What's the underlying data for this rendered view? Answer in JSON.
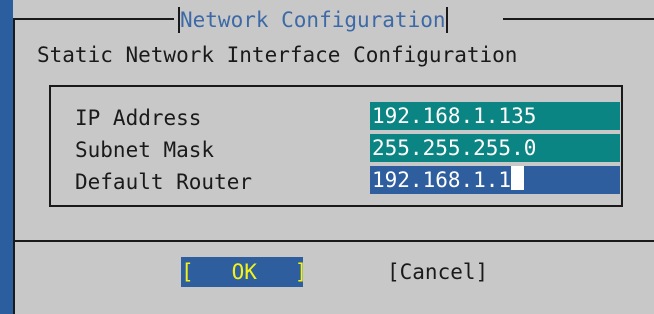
{
  "dialog": {
    "title": "Network Configuration",
    "subtitle": "Static Network Interface Configuration",
    "fields": [
      {
        "label": "IP Address",
        "value": "192.168.1.135",
        "active": false
      },
      {
        "label": "Subnet Mask",
        "value": "255.255.255.0",
        "active": false
      },
      {
        "label": "Default Router",
        "value": "192.168.1.1",
        "active": true
      }
    ],
    "buttons": {
      "ok_label": "[   OK   ]",
      "cancel_label": "[Cancel]"
    }
  },
  "colors": {
    "background": "#2a5e9e",
    "dialog": "#c8c8c8",
    "title": "#3d6aa6",
    "field_inactive": "#0a8583",
    "field_active": "#2f5e9e",
    "ok_text": "#f3f31a"
  }
}
